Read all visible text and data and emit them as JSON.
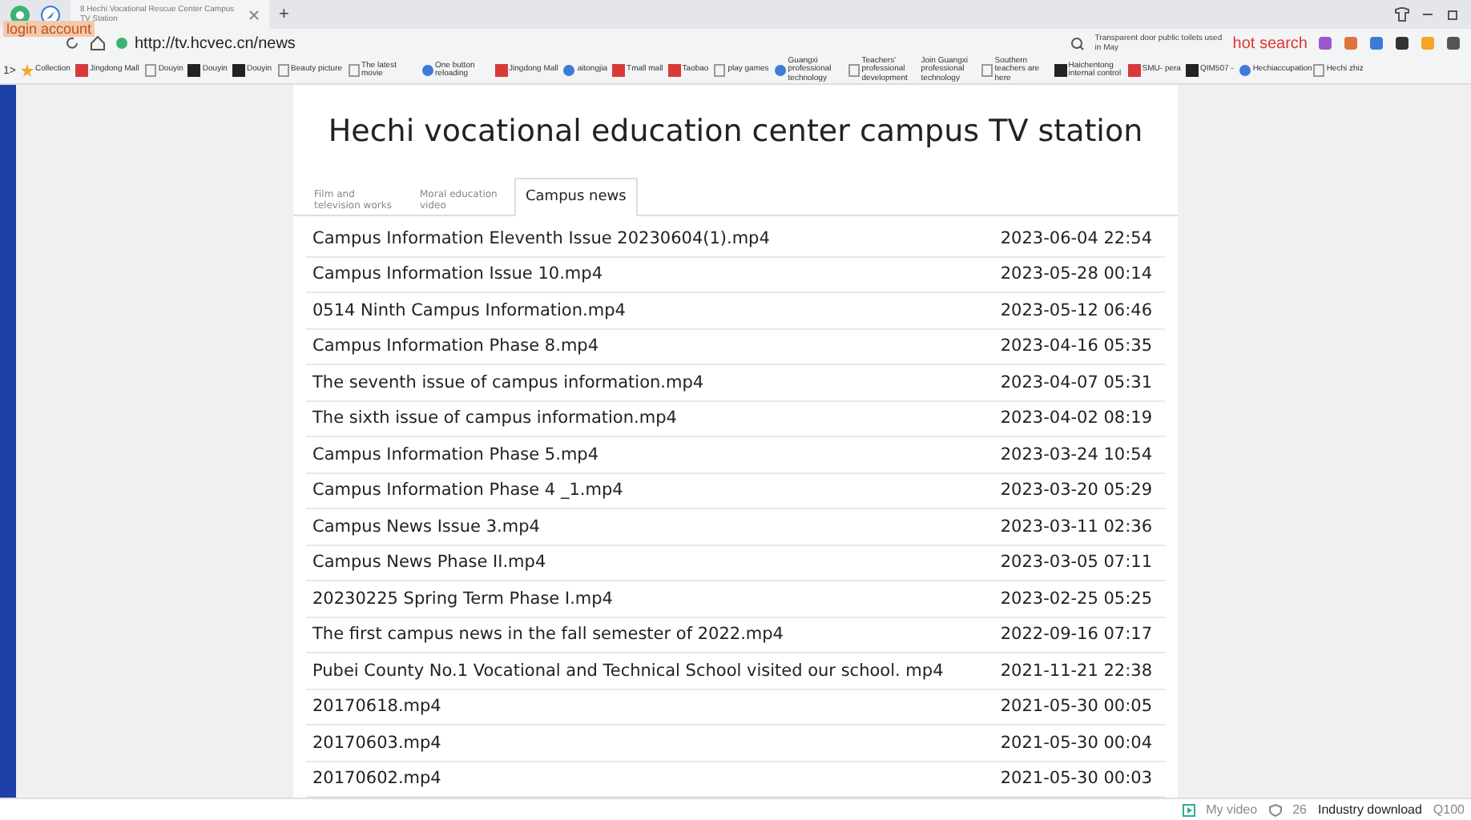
{
  "browser": {
    "tab_title": "8 Hechi Vocational Rescue Center Campus TV Station",
    "new_tab": "+",
    "login": "login account",
    "url": "http://tv.hcvec.cn/news",
    "search_hint": "Transparent door public toilets used in May",
    "hot_search": "hot search",
    "bookmarks_toggle": "1>",
    "bookmarks": [
      {
        "label": "Collection",
        "kind": "star"
      },
      {
        "label": "Jingdong Mall",
        "kind": "red"
      },
      {
        "label": "Douyin",
        "kind": "page"
      },
      {
        "label": "Douyin",
        "kind": "dark"
      },
      {
        "label": "Douyin",
        "kind": "dark"
      },
      {
        "label": "Beauty picture",
        "kind": "page"
      },
      {
        "label": "The latest movie",
        "kind": "page"
      },
      {
        "label": "One button reloading",
        "kind": "dot"
      },
      {
        "label": "Jingdong Mall",
        "kind": "red"
      },
      {
        "label": "aitongjia",
        "kind": "dot"
      },
      {
        "label": "Tmall mall",
        "kind": "red"
      },
      {
        "label": "Taobao",
        "kind": "red"
      },
      {
        "label": "play games",
        "kind": "page"
      },
      {
        "label": "Guangxi professional technology",
        "kind": "dot"
      },
      {
        "label": "Teachers' professional development",
        "kind": "page"
      },
      {
        "label": "Join Guangxi professional technology",
        "kind": "none"
      },
      {
        "label": "Southern teachers are here",
        "kind": "page"
      },
      {
        "label": "Haichentong internal control",
        "kind": "dark"
      },
      {
        "label": "SMU- pera",
        "kind": "red"
      },
      {
        "label": "QIM507 -",
        "kind": "dark"
      },
      {
        "label": "Hechiaccupation",
        "kind": "dot"
      },
      {
        "label": "Hechi zhiz",
        "kind": "page"
      }
    ]
  },
  "page": {
    "title": "Hechi vocational education center campus TV station",
    "tabs": [
      {
        "label": "Film and television works",
        "selected": false
      },
      {
        "label": "Moral education video",
        "selected": false
      },
      {
        "label": "Campus news",
        "selected": true
      }
    ],
    "rows": [
      {
        "name": "Campus Information Eleventh Issue 20230604(1).mp4",
        "date": "2023-06-04 22:54"
      },
      {
        "name": "Campus Information Issue 10.mp4",
        "date": "2023-05-28 00:14"
      },
      {
        "name": "0514 Ninth Campus Information.mp4",
        "date": "2023-05-12 06:46"
      },
      {
        "name": "Campus Information Phase 8.mp4",
        "date": "2023-04-16 05:35"
      },
      {
        "name": "The seventh issue of campus information.mp4",
        "date": "2023-04-07 05:31"
      },
      {
        "name": "The sixth issue of campus information.mp4",
        "date": "2023-04-02 08:19"
      },
      {
        "name": "Campus Information Phase 5.mp4",
        "date": "2023-03-24 10:54"
      },
      {
        "name": "Campus Information Phase 4 _1.mp4",
        "date": "2023-03-20 05:29"
      },
      {
        "name": "Campus News Issue 3.mp4",
        "date": "2023-03-11 02:36"
      },
      {
        "name": "Campus News Phase II.mp4",
        "date": "2023-03-05 07:11"
      },
      {
        "name": "20230225 Spring Term Phase I.mp4",
        "date": "2023-02-25 05:25"
      },
      {
        "name": "The first campus news in the fall semester of 2022.mp4",
        "date": "2022-09-16 07:17"
      },
      {
        "name": "Pubei County No.1 Vocational and Technical School visited our school. mp4",
        "date": "2021-11-21 22:38"
      },
      {
        "name": "20170618.mp4",
        "date": "2021-05-30 00:05"
      },
      {
        "name": "20170603.mp4",
        "date": "2021-05-30 00:04"
      },
      {
        "name": "20170602.mp4",
        "date": "2021-05-30 00:03"
      }
    ]
  },
  "status_bar": {
    "my_video": "My video",
    "count": "26",
    "download": "Industry download",
    "zoom": "Q100"
  }
}
